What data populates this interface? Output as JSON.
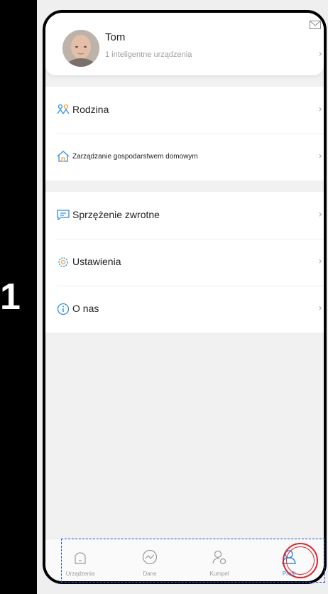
{
  "step": {
    "number": "1"
  },
  "profile": {
    "name": "Tom",
    "devices": "1 inteligentne urządzenia"
  },
  "menu": {
    "family": "Rodzina",
    "home_management": "Zarządzanie gospodarstwem domowym",
    "feedback": "Sprzężenie zwrotne",
    "settings": "Ustawienia",
    "about": "O nas"
  },
  "tabs": [
    {
      "label": "Urządzenia",
      "icon": "home-icon",
      "active": false
    },
    {
      "label": "Dane",
      "icon": "chart-icon",
      "active": false
    },
    {
      "label": "Kumpel",
      "icon": "friend-icon",
      "active": false
    },
    {
      "label": "Profil",
      "icon": "user-icon",
      "active": true
    }
  ],
  "colors": {
    "accent": "#2f8fe6",
    "annotation_red": "#d7262b",
    "annotation_blue": "#1f4fd8"
  }
}
